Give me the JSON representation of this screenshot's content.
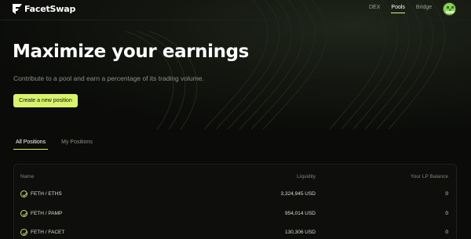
{
  "brand": {
    "name": "FacetSwap"
  },
  "nav": {
    "links": [
      {
        "label": "DEX",
        "active": false
      },
      {
        "label": "Pools",
        "active": true
      },
      {
        "label": "Bridge",
        "active": false
      }
    ]
  },
  "hero": {
    "title": "Maximize your earnings",
    "subtitle": "Contribute to a pool and earn a percentage of its trading volume.",
    "cta_label": "Create a new position"
  },
  "tabs": [
    {
      "label": "All Positions",
      "active": true
    },
    {
      "label": "My Positions",
      "active": false
    }
  ],
  "table": {
    "headers": {
      "name": "Name",
      "liquidity": "Liquidity",
      "balance": "Your LP Balance"
    },
    "rows": [
      {
        "name": "FETH / ETHS",
        "liquidity": "3,324,945 USD",
        "balance": "0"
      },
      {
        "name": "FETH / PAMP",
        "liquidity": "954,014 USD",
        "balance": "0"
      },
      {
        "name": "FETH / FACET",
        "liquidity": "130,306 USD",
        "balance": "0"
      }
    ]
  },
  "colors": {
    "accent": "#d9f46a",
    "background": "#0b0c0a"
  }
}
